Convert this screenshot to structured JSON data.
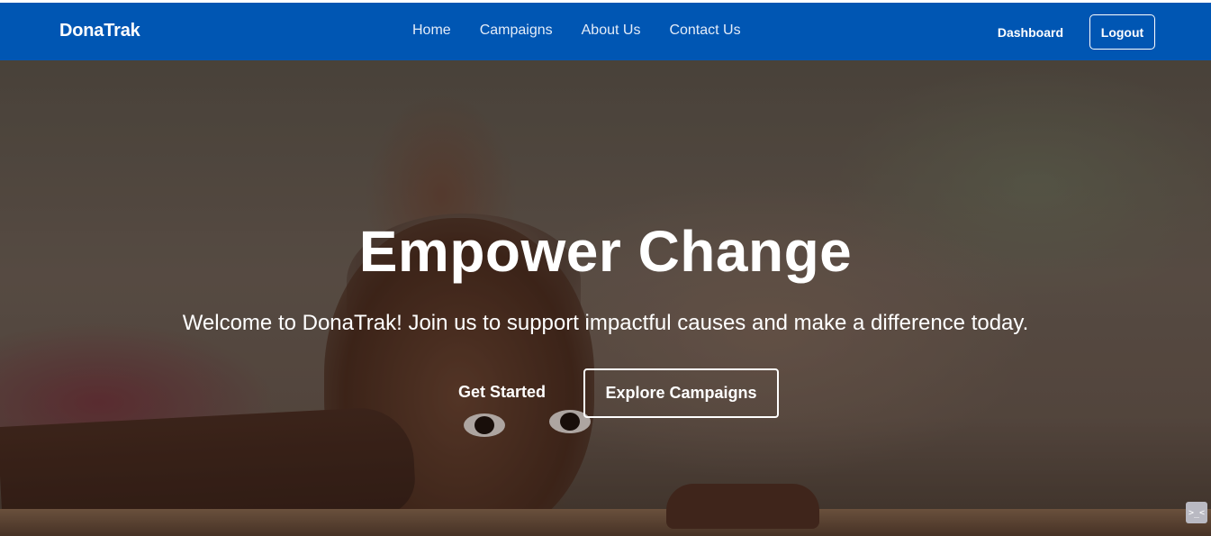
{
  "navbar": {
    "brand": "DonaTrak",
    "links": [
      {
        "label": "Home"
      },
      {
        "label": "Campaigns"
      },
      {
        "label": "About Us"
      },
      {
        "label": "Contact Us"
      }
    ],
    "dashboard_label": "Dashboard",
    "logout_label": "Logout",
    "bg_color": "#0056b3"
  },
  "hero": {
    "title": "Empower Change",
    "subtitle": "Welcome to DonaTrak! Join us to support impactful causes and make a difference today.",
    "primary_cta": "Get Started",
    "secondary_cta": "Explore Campaigns",
    "image_subject": "child-peeking-over-ledge"
  },
  "side_widget": {
    "icon": "collapse-arrows-icon",
    "glyph": ">_<"
  }
}
